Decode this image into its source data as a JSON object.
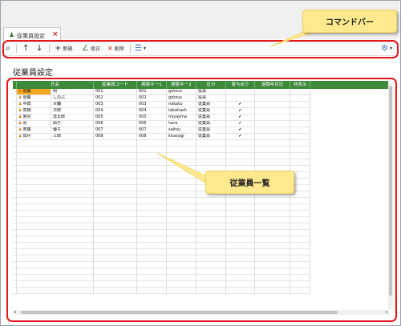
{
  "tab": {
    "icon": "person-icon",
    "label": "従業員設定",
    "close": "×"
  },
  "toolbar": {
    "search_icon": "⌕",
    "up_icon": "↑",
    "down_icon": "↓",
    "new_icon": "+",
    "new_label": "新規",
    "edit_icon": "∠",
    "edit_label": "修正",
    "delete_icon": "✕",
    "delete_label": "削除",
    "menu_icon": "☰",
    "menu_chevron": "▾",
    "settings_icon": "⚙"
  },
  "callouts": {
    "command_bar": "コマンドバー",
    "employee_list": "従業員一覧"
  },
  "page_title": "従業員設定",
  "grid": {
    "columns": [
      "氏名",
      "従業員コード",
      "検索キー1",
      "検索キー2",
      "区分",
      "賞与あり",
      "退職年月日",
      "非表示"
    ],
    "rows": [
      {
        "sei": "後藤",
        "mei": "明",
        "code": "001",
        "key1": "001",
        "key2": "gotous",
        "kubun": "役員",
        "bonus": "",
        "retire": "",
        "hidden": ""
      },
      {
        "sei": "後藤",
        "mei": "しのぶ",
        "code": "002",
        "key1": "002",
        "key2": "gotous",
        "kubun": "役員",
        "bonus": "",
        "retire": "",
        "hidden": ""
      },
      {
        "sei": "中田",
        "mei": "大輔",
        "code": "003",
        "key1": "003",
        "key2": "nakata",
        "kubun": "従業員",
        "bonus": "✔",
        "retire": "",
        "hidden": ""
      },
      {
        "sei": "高橋",
        "mei": "次郎",
        "code": "004",
        "key1": "004",
        "key2": "takahash",
        "kubun": "従業員",
        "bonus": "✔",
        "retire": "",
        "hidden": ""
      },
      {
        "sei": "宮島",
        "mei": "達太郎",
        "code": "005",
        "key1": "005",
        "key2": "miyajima",
        "kubun": "従業員",
        "bonus": "✔",
        "retire": "",
        "hidden": ""
      },
      {
        "sei": "原",
        "mei": "由子",
        "code": "006",
        "key1": "006",
        "key2": "hara",
        "kubun": "従業員",
        "bonus": "✔",
        "retire": "",
        "hidden": ""
      },
      {
        "sei": "斎藤",
        "mei": "優子",
        "code": "007",
        "key1": "007",
        "key2": "saitou",
        "kubun": "従業員",
        "bonus": "✔",
        "retire": "",
        "hidden": ""
      },
      {
        "sei": "如月",
        "mei": "三郎",
        "code": "008",
        "key1": "008",
        "key2": "kisaragi",
        "kubun": "従業員",
        "bonus": "✔",
        "retire": "",
        "hidden": ""
      }
    ],
    "empty_rows": 24
  },
  "colors": {
    "header_green": "#3d8a3a",
    "highlight_red": "#e3161c",
    "selection_orange": "#f5a623",
    "callout_yellow": "#ffe98f"
  }
}
